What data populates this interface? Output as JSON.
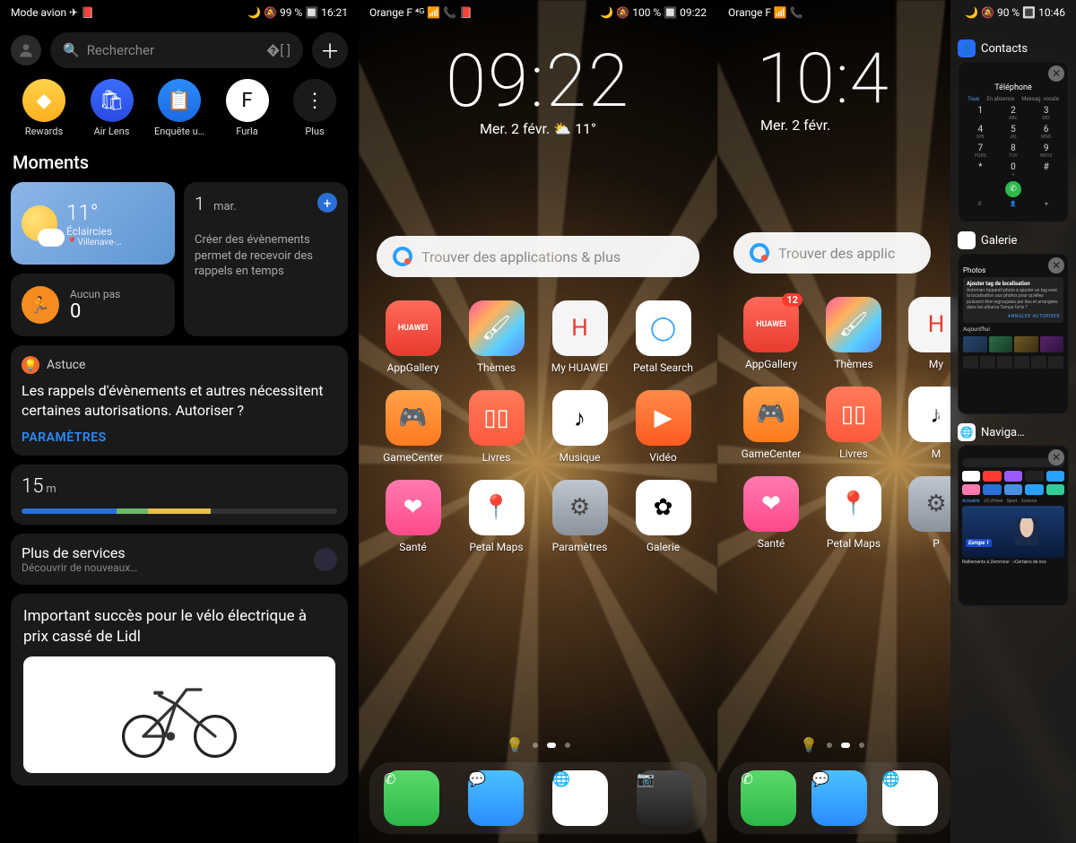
{
  "phone1": {
    "status_left": "Mode avion ✈ 📕",
    "status_right": "🌙 🔕 99 % 🔲 16:21",
    "search_placeholder": "Rechercher",
    "apps": [
      {
        "name": "rewards",
        "label": "Rewards",
        "emoji": "◆",
        "bg": "linear-gradient(#ffd24a,#ffb01f)"
      },
      {
        "name": "airlens",
        "label": "Air Lens",
        "emoji": "🛍",
        "bg": "linear-gradient(#3a6cff,#2a4ae0)"
      },
      {
        "name": "enquete",
        "label": "Enquête u…",
        "emoji": "📋",
        "bg": "linear-gradient(#2a8cff,#1a6ae0)"
      },
      {
        "name": "furla",
        "label": "Furla",
        "emoji": "F",
        "bg": "#fff",
        "fg": "#000"
      },
      {
        "name": "plus",
        "label": "Plus",
        "emoji": "⋮",
        "bg": "#1a1a1a"
      }
    ],
    "moments_header": "Moments",
    "weather": {
      "temp": "11°",
      "cond": "Éclaircies",
      "city": "📍Villenave-…"
    },
    "steps": {
      "label": "Aucun pas",
      "value": "0"
    },
    "calendar": {
      "day": "1",
      "dow": "mar.",
      "hint": "Créer des évènements permet de recevoir des rappels en temps"
    },
    "tip": {
      "label": "Astuce",
      "body": "Les rappels d'évènements et autres nécessitent certaines autorisations. Autoriser ?",
      "link": "PARAMÈTRES"
    },
    "distance": {
      "value": "15",
      "unit": "m"
    },
    "services": {
      "title": "Plus de services",
      "sub": "Découvrir de nouveaux…"
    },
    "news": {
      "headline": "Important succès pour le vélo électrique à prix cassé de Lidl"
    }
  },
  "phone2": {
    "status_left": "Orange F ⁴ᴳ 📶 📞 📕",
    "status_right": "🌙 🔕 100 % 🔲 09:22",
    "time": "09:22",
    "date": "Mer. 2 févr.   ⛅ 11°",
    "search_placeholder": "Trouver des applications & plus",
    "row1": [
      {
        "name": "appgallery",
        "label": "AppGallery",
        "cls": "ic-red",
        "glyph": "HUAWEI",
        "gsize": "9px"
      },
      {
        "name": "themes",
        "label": "Thèmes",
        "cls": "ic-rain",
        "glyph": "🖌"
      },
      {
        "name": "myhuawei",
        "label": "My HUAWEI",
        "cls": "ic-white",
        "glyph": "H",
        "badge": ""
      },
      {
        "name": "petalsearch",
        "label": "Petal Search",
        "cls": "ic-blue",
        "glyph": "◯"
      }
    ],
    "row2": [
      {
        "name": "gamecenter",
        "label": "GameCenter",
        "cls": "ic-orange",
        "glyph": "🎮"
      },
      {
        "name": "livres",
        "label": "Livres",
        "cls": "ic-book",
        "glyph": "▯▯"
      },
      {
        "name": "musique",
        "label": "Musique",
        "cls": "ic-music",
        "glyph": "♪"
      },
      {
        "name": "video",
        "label": "Vidéo",
        "cls": "ic-orange2",
        "glyph": "▶"
      }
    ],
    "row3": [
      {
        "name": "sante",
        "label": "Santé",
        "cls": "ic-pink",
        "glyph": "❤"
      },
      {
        "name": "petalmaps",
        "label": "Petal Maps",
        "cls": "ic-map",
        "glyph": "📍"
      },
      {
        "name": "parametres",
        "label": "Paramètres",
        "cls": "ic-gear",
        "glyph": "⚙"
      },
      {
        "name": "galerie",
        "label": "Galerie",
        "cls": "ic-flower",
        "glyph": "✿"
      }
    ],
    "dock": [
      {
        "name": "phone",
        "cls": "ic-green",
        "glyph": "✆"
      },
      {
        "name": "messages",
        "cls": "ic-msg",
        "glyph": "💬"
      },
      {
        "name": "browser",
        "cls": "ic-browser",
        "glyph": "🌐"
      },
      {
        "name": "camera",
        "cls": "ic-dark",
        "glyph": "📷"
      }
    ]
  },
  "phone3": {
    "status_left": "Orange F  📶 📞",
    "status_right": "🌙 🔕 90 % 🔳 10:46",
    "time": "10:4",
    "date": "Mer. 2 févr.",
    "search_placeholder": "Trouver des applic",
    "row1": [
      {
        "name": "appgallery",
        "label": "AppGallery",
        "cls": "ic-red",
        "glyph": "HUAWEI",
        "gsize": "9px",
        "badge": "12"
      },
      {
        "name": "themes",
        "label": "Thèmes",
        "cls": "ic-rain",
        "glyph": "🖌"
      },
      {
        "name": "myhuawei",
        "label": "My",
        "cls": "ic-white",
        "glyph": "H"
      }
    ],
    "row2": [
      {
        "name": "gamecenter",
        "label": "GameCenter",
        "cls": "ic-orange",
        "glyph": "🎮"
      },
      {
        "name": "livres",
        "label": "Livres",
        "cls": "ic-book",
        "glyph": "▯▯"
      },
      {
        "name": "musique",
        "label": "M",
        "cls": "ic-music",
        "glyph": "♪"
      }
    ],
    "row3": [
      {
        "name": "sante",
        "label": "Santé",
        "cls": "ic-pink",
        "glyph": "❤"
      },
      {
        "name": "petalmaps",
        "label": "Petal Maps",
        "cls": "ic-map",
        "glyph": "📍"
      },
      {
        "name": "parametres",
        "label": "P",
        "cls": "ic-gear",
        "glyph": "⚙"
      }
    ],
    "dock": [
      {
        "name": "phone",
        "cls": "ic-green",
        "glyph": "✆"
      },
      {
        "name": "messages",
        "cls": "ic-msg",
        "glyph": "💬"
      },
      {
        "name": "browser",
        "cls": "ic-browser",
        "glyph": "🌐"
      }
    ],
    "recents": [
      {
        "name": "contacts",
        "label": "Contacts",
        "iconbg": "#2a6cff",
        "iconglyph": "👤",
        "dialer": {
          "title": "Téléphone",
          "tabs": [
            "Tous",
            "En absence",
            "Messag. vocale"
          ],
          "keys": [
            [
              "1",
              ""
            ],
            [
              "2",
              "ABC"
            ],
            [
              "3",
              "DEF"
            ],
            [
              "4",
              "GHI"
            ],
            [
              "5",
              "JKL"
            ],
            [
              "6",
              "MNO"
            ],
            [
              "7",
              "PQRS"
            ],
            [
              "8",
              "TUV"
            ],
            [
              "9",
              "WXYZ"
            ],
            [
              "*",
              ""
            ],
            [
              "0",
              "+"
            ],
            [
              "#",
              ""
            ]
          ]
        }
      },
      {
        "name": "galerie",
        "label": "Galerie",
        "iconbg": "#fff",
        "iconglyph": "✿",
        "gallery": {
          "header": "Photos",
          "dlg_title": "Ajouter tag de localisation",
          "dlg_body": "Autoriser Appareil photo à ajouter un tag avec la localisation aux photos pour qu'elles puissent être regroupées par lieu et arrangées dans les albums Temps forts ?",
          "dlg_buttons": "ANNULER   AUTORISER",
          "section": "Aujourd'hui"
        }
      },
      {
        "name": "navigateur",
        "label": "Naviga…",
        "iconbg": "#fff",
        "iconglyph": "🌐",
        "browser": {
          "favs": [
            "#fff",
            "#ff3b30",
            "#9b5aff",
            "#222",
            "#2aa0ff",
            "#ff7ab0",
            "#2a6fd6",
            "#4a90e2",
            "#2aa0ff",
            "#3c9"
          ],
          "tabs": [
            "Actualité",
            "JO d'hiver",
            "Sport",
            "Science"
          ],
          "banner": "Europe 1",
          "caption": "Ralliements à Zemmour : «Certains de nos"
        }
      }
    ]
  }
}
